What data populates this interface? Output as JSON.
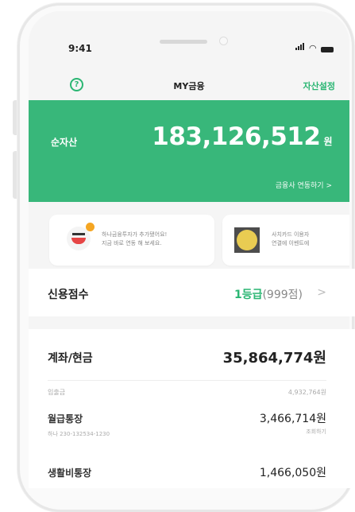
{
  "status_bar": {
    "time": "9:41"
  },
  "nav": {
    "help_glyph": "?",
    "title": "MY금융",
    "right_link": "자산설정"
  },
  "net_asset": {
    "label": "순자산",
    "amount": "183,126,512",
    "unit": "원",
    "link": "금융사 연동하기 >"
  },
  "banners": [
    {
      "icon": "smiling-face-icon",
      "line1": "하나금융투자가 추가됐어요!",
      "line2": "지금 바로 연동 해 보세요."
    },
    {
      "icon": "emoji-face-icon",
      "line1": "사치카드 이용자",
      "line2": "연결에 이벤트에"
    }
  ],
  "credit_score": {
    "label": "신용점수",
    "grade": "1등급",
    "points": "(999점)",
    "chevron": ">"
  },
  "accounts": {
    "label": "계좌/현금",
    "total": "35,864,774원",
    "sub_left": "입출금",
    "sub_right": "4,932,764원",
    "items": [
      {
        "name": "월급통장",
        "number": "하나 230-132534-1230",
        "amount": "3,466,714원",
        "action": "조회하기"
      },
      {
        "name": "생활비통장",
        "amount": "1,466,050원"
      }
    ]
  },
  "colors": {
    "accent": "#38b77a",
    "text": "#222222",
    "muted": "#aaaaaa"
  }
}
